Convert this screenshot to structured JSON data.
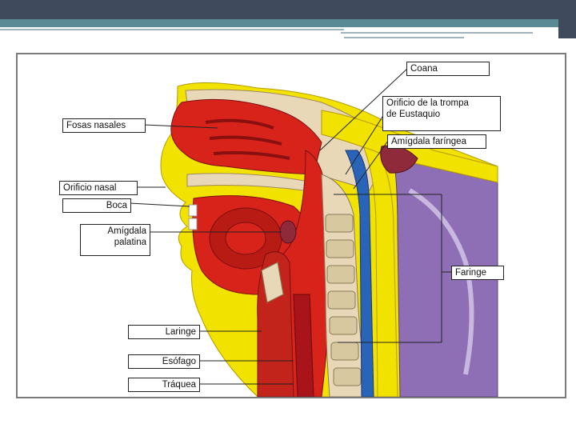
{
  "labels": {
    "fosas_nasales": "Fosas nasales",
    "orificio_nasal": "Orificio nasal",
    "boca": "Boca",
    "amigdala_palatina_1": "Amígdala",
    "amigdala_palatina_2": "palatina",
    "laringe": "Laringe",
    "esofago": "Esófago",
    "traquea": "Tráquea",
    "coana": "Coana",
    "orificio_trompa_1": "Orificio de la trompa",
    "orificio_trompa_2": "de Eustaquio",
    "amigdala_faringea": "Amígdala faríngea",
    "faringe": "Faringe"
  },
  "colors": {
    "header_dark": "#3f4a5c",
    "header_accent": "#5a8a94",
    "tissue_red": "#d8231b",
    "skin_yellow": "#f2e200",
    "bone_beige": "#e8d8b8",
    "spine_purple": "#8e6fb5",
    "vessel_blue": "#2a64b8"
  }
}
